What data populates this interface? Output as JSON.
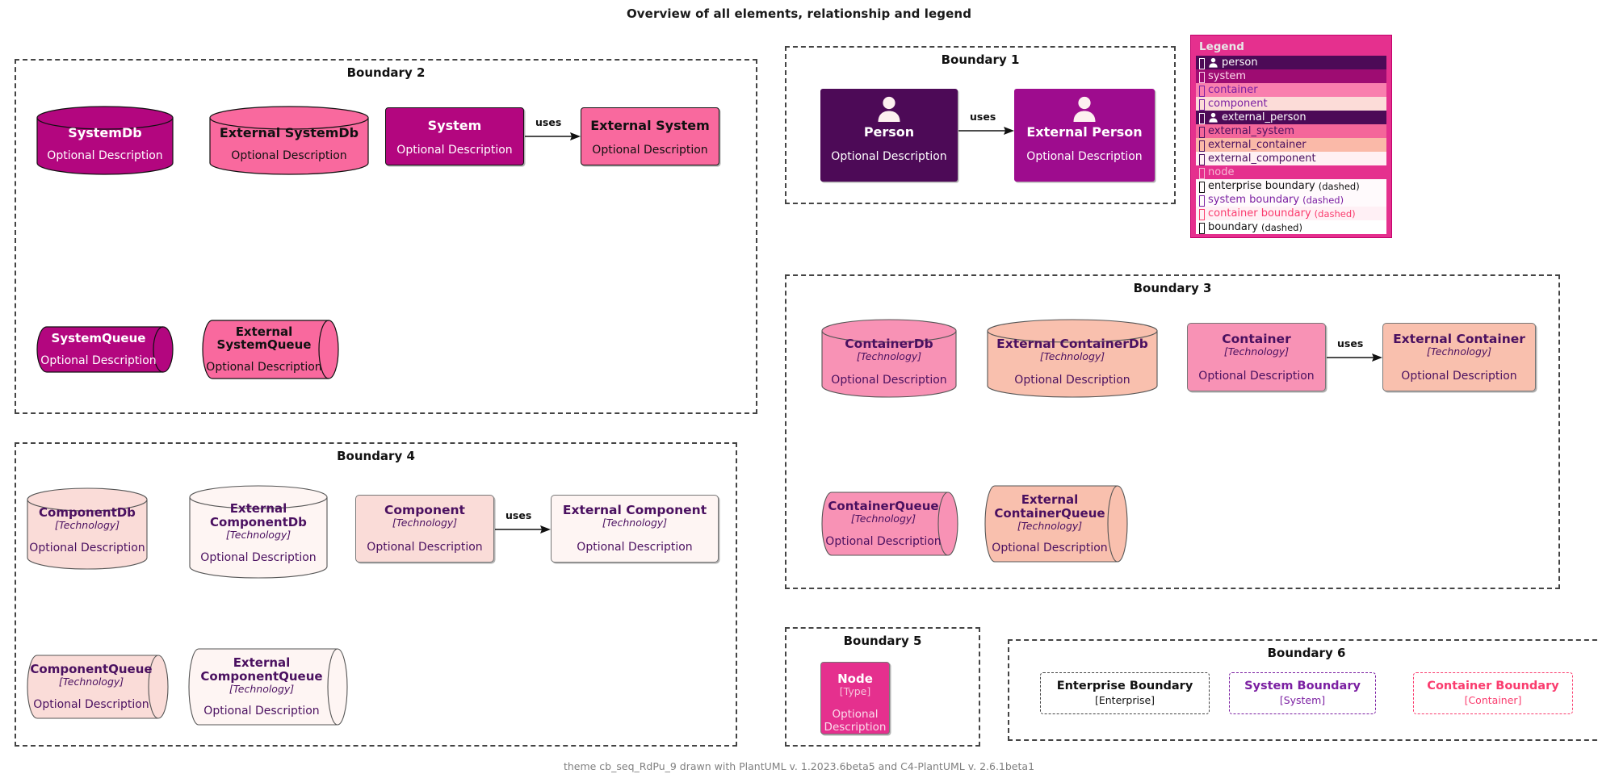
{
  "title": "Overview of all elements, relationship and legend",
  "footer": "theme cb_seq_RdPu_9 drawn with PlantUML v. 1.2023.6beta5 and C4-PlantUML v. 2.6.1beta1",
  "labels": {
    "uses": "uses",
    "optional_description": "Optional Description",
    "technology": "[Technology]",
    "type": "[Type]"
  },
  "boundaries": {
    "b1": "Boundary 1",
    "b2": "Boundary 2",
    "b3": "Boundary 3",
    "b4": "Boundary 4",
    "b5": "Boundary 5",
    "b6": "Boundary 6"
  },
  "elements": {
    "person": {
      "name": "Person",
      "desc": "Optional Description"
    },
    "external_person": {
      "name": "External Person",
      "desc": "Optional Description"
    },
    "system_db": {
      "name": "SystemDb",
      "desc": "Optional Description"
    },
    "external_system_db": {
      "name": "External SystemDb",
      "desc": "Optional Description"
    },
    "system": {
      "name": "System",
      "desc": "Optional Description"
    },
    "external_system": {
      "name": "External System",
      "desc": "Optional Description"
    },
    "system_queue": {
      "name": "SystemQueue",
      "desc": "Optional Description"
    },
    "external_system_queue": {
      "name": "External\nSystemQueue",
      "desc": "Optional Description"
    },
    "container_db": {
      "name": "ContainerDb",
      "tech": "[Technology]",
      "desc": "Optional Description"
    },
    "external_container_db": {
      "name": "External ContainerDb",
      "tech": "[Technology]",
      "desc": "Optional Description"
    },
    "container": {
      "name": "Container",
      "tech": "[Technology]",
      "desc": "Optional Description"
    },
    "external_container": {
      "name": "External Container",
      "tech": "[Technology]",
      "desc": "Optional Description"
    },
    "container_queue": {
      "name": "ContainerQueue",
      "tech": "[Technology]",
      "desc": "Optional Description"
    },
    "external_container_queue": {
      "name": "External\nContainerQueue",
      "tech": "[Technology]",
      "desc": "Optional Description"
    },
    "component_db": {
      "name": "ComponentDb",
      "tech": "[Technology]",
      "desc": "Optional Description"
    },
    "external_component_db": {
      "name": "External\nComponentDb",
      "tech": "[Technology]",
      "desc": "Optional Description"
    },
    "component": {
      "name": "Component",
      "tech": "[Technology]",
      "desc": "Optional Description"
    },
    "external_component": {
      "name": "External Component",
      "tech": "[Technology]",
      "desc": "Optional Description"
    },
    "component_queue": {
      "name": "ComponentQueue",
      "tech": "[Technology]",
      "desc": "Optional Description"
    },
    "external_component_queue": {
      "name": "External\nComponentQueue",
      "tech": "[Technology]",
      "desc": "Optional Description"
    },
    "node": {
      "name": "Node",
      "tech": "[Type]",
      "desc": "Optional Description"
    },
    "enterprise_boundary": {
      "name": "Enterprise Boundary",
      "tech": "[Enterprise]"
    },
    "system_boundary": {
      "name": "System Boundary",
      "tech": "[System]"
    },
    "container_boundary": {
      "name": "Container Boundary",
      "tech": "[Container]"
    }
  },
  "relationships": [
    {
      "from": "person",
      "to": "external_person",
      "label": "uses"
    },
    {
      "from": "system",
      "to": "external_system",
      "label": "uses"
    },
    {
      "from": "container",
      "to": "external_container",
      "label": "uses"
    },
    {
      "from": "component",
      "to": "external_component",
      "label": "uses"
    }
  ],
  "legend": {
    "title": "Legend",
    "rows": [
      {
        "label": "person",
        "suffix": "",
        "icon": "person-icon",
        "bg": "#4D0A57",
        "fg": "#FFFFFF",
        "swatch": "#FFFFFF"
      },
      {
        "label": "system",
        "suffix": "",
        "icon": "square",
        "bg": "#9E0C72",
        "fg": "#FFD9EC",
        "swatch": "#FFD9EC"
      },
      {
        "label": "container",
        "suffix": "",
        "icon": "square",
        "bg": "#F97FAE",
        "fg": "#7B1FA2",
        "swatch": "#7B1FA2"
      },
      {
        "label": "component",
        "suffix": "",
        "icon": "square",
        "bg": "#FCDCD8",
        "fg": "#7B1FA2",
        "swatch": "#7B1FA2"
      },
      {
        "label": "external_person",
        "suffix": "",
        "icon": "person-icon",
        "bg": "#4D0A57",
        "fg": "#FFFFFF",
        "swatch": "#FFFFFF"
      },
      {
        "label": "external_system",
        "suffix": "",
        "icon": "square",
        "bg": "#F4669A",
        "fg": "#4A1060",
        "swatch": "#4A1060"
      },
      {
        "label": "external_container",
        "suffix": "",
        "icon": "square",
        "bg": "#FAB9A8",
        "fg": "#4A1060",
        "swatch": "#4A1060"
      },
      {
        "label": "external_component",
        "suffix": "",
        "icon": "square",
        "bg": "#FFF0F3",
        "fg": "#4A1060",
        "swatch": "#4A1060"
      },
      {
        "label": "node",
        "suffix": "",
        "icon": "square",
        "bg": "#E5308E",
        "fg": "#F7B8D4",
        "swatch": "#F7B8D4"
      },
      {
        "label": "enterprise boundary",
        "suffix": "(dashed)",
        "icon": "square",
        "bg": "#FFFAFC",
        "fg": "#111111",
        "swatch": "#111111"
      },
      {
        "label": "system boundary",
        "suffix": "(dashed)",
        "icon": "square",
        "bg": "#FFFAFC",
        "fg": "#7B1FA2",
        "swatch": "#7B1FA2"
      },
      {
        "label": "container boundary",
        "suffix": "(dashed)",
        "icon": "square",
        "bg": "#FFF0F5",
        "fg": "#FA3C6E",
        "swatch": "#FA3C6E"
      },
      {
        "label": "boundary",
        "suffix": "(dashed)",
        "icon": "square",
        "bg": "#FFFFFF",
        "fg": "#111111",
        "swatch": "#111111"
      }
    ]
  },
  "colors": {
    "person_bg": "#4D0A57",
    "external_person_bg": "#9E0C8E",
    "system_bg": "#B3067F",
    "external_system_bg": "#F9699E",
    "container_bg": "#F892B5",
    "external_container_bg": "#F9C0AE",
    "component_bg": "#FADCD8",
    "external_component_bg": "#FEF5F3",
    "node_bg": "#E5308E",
    "legend_bg": "#E5308E",
    "purple_text": "#4A1060",
    "boundary_stroke": "#444444",
    "container_boundary_stroke": "#FA3C6E",
    "system_boundary_stroke": "#7B1FA2"
  }
}
